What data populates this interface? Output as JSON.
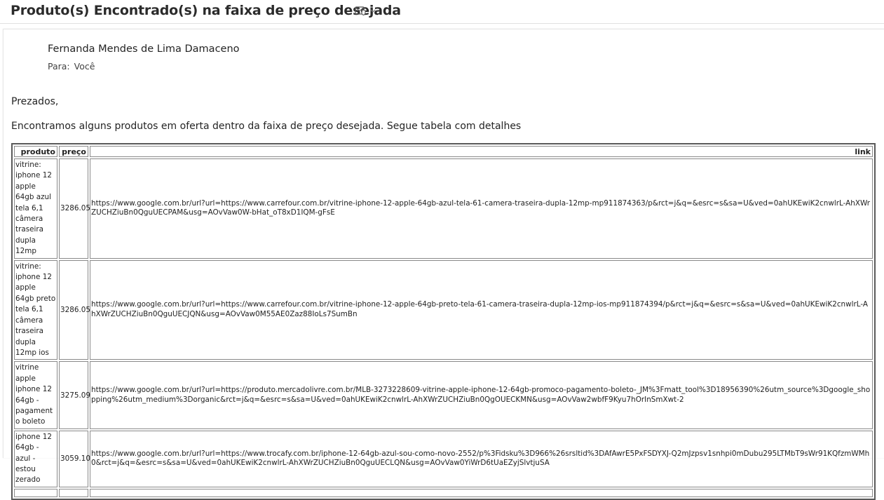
{
  "email": {
    "subject": "Produto(s) Encontrado(s) na faixa de preço desejada",
    "sender": "Fernanda Mendes de Lima Damaceno",
    "to_label": "Para:",
    "to_value": "Você",
    "greeting": "Prezados,",
    "intro": "Encontramos alguns produtos em oferta dentro da faixa de preço desejada. Segue tabela com detalhes"
  },
  "icons": {
    "subject_action": "envelope-shield-icon",
    "dropdown": "chevron-down-icon"
  },
  "table": {
    "headers": {
      "produto": "produto",
      "preco": "preço",
      "link": "link"
    },
    "rows": [
      {
        "produto": "vitrine: iphone 12 apple 64gb azul tela 6,1 câmera traseira dupla 12mp",
        "preco": "3286.05",
        "link": "https://www.google.com.br/url?url=https://www.carrefour.com.br/vitrine-iphone-12-apple-64gb-azul-tela-61-camera-traseira-dupla-12mp-mp911874363/p&rct=j&q=&esrc=s&sa=U&ved=0ahUKEwiK2cnwlrL-AhXWrZUCHZiuBn0QguUECPAM&usg=AOvVaw0W-bHat_oT8xD1IQM-gFsE"
      },
      {
        "produto": "vitrine: iphone 12 apple 64gb preto tela 6,1 câmera traseira dupla 12mp ios",
        "preco": "3286.05",
        "link": "https://www.google.com.br/url?url=https://www.carrefour.com.br/vitrine-iphone-12-apple-64gb-preto-tela-61-camera-traseira-dupla-12mp-ios-mp911874394/p&rct=j&q=&esrc=s&sa=U&ved=0ahUKEwiK2cnwlrL-AhXWrZUCHZiuBn0QguUECJQN&usg=AOvVaw0M55AE0Zaz88IoLs7SumBn"
      },
      {
        "produto": "vitrine apple iphone 12 64gb - pagamento boleto",
        "preco": "3275.09",
        "link": "https://www.google.com.br/url?url=https://produto.mercadolivre.com.br/MLB-3273228609-vitrine-apple-iphone-12-64gb-promoco-pagamento-boleto-_JM%3Fmatt_tool%3D18956390%26utm_source%3Dgoogle_shopping%26utm_medium%3Dorganic&rct=j&q=&esrc=s&sa=U&ved=0ahUKEwiK2cnwlrL-AhXWrZUCHZiuBn0QgOUECKMN&usg=AOvVaw2wbfF9Kyu7hOrInSmXwt-2"
      },
      {
        "produto": "iphone 12 64gb - azul - estou zerado",
        "preco": "3059.10",
        "link": "https://www.google.com.br/url?url=https://www.trocafy.com.br/iphone-12-64gb-azul-sou-como-novo-2552/p%3Fidsku%3D966%26srsltid%3DAfAwrE5PxFSDYXJ-Q2mJzpsv1snhpi0mDubu295LTMbT9sWr91KQfzmWMh0&rct=j&q=&esrc=s&sa=U&ved=0ahUKEwiK2cnwlrL-AhXWrZUCHZiuBn0QguUECLQN&usg=AOvVaw0YiWrD6tUaEZyjSlvtjuSA"
      }
    ]
  }
}
